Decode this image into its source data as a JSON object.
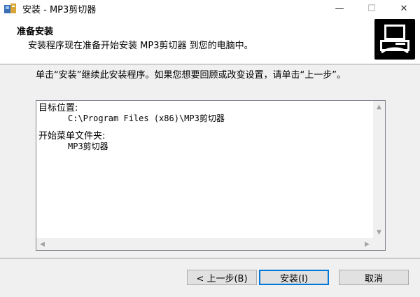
{
  "window": {
    "title": "安装 - MP3剪切器",
    "controls": {
      "minimize": "—",
      "maximize": "☐",
      "close": "✕"
    }
  },
  "header": {
    "title": "准备安装",
    "subtitle": "安装程序现在准备开始安装 MP3剪切器 到您的电脑中。"
  },
  "main": {
    "intro": "单击“安装”继续此安装程序。如果您想要回顾或改变设置，请单击“上一步”。",
    "info": {
      "dest_label": "目标位置:",
      "dest_value": "C:\\Program Files (x86)\\MP3剪切器",
      "menu_label": "开始菜单文件夹:",
      "menu_value": "MP3剪切器"
    }
  },
  "buttons": {
    "back": "< 上一步(B)",
    "install": "安装(I)",
    "cancel": "取消"
  },
  "colors": {
    "focus_border": "#0078d7",
    "window_bg": "#f0f0f0"
  }
}
